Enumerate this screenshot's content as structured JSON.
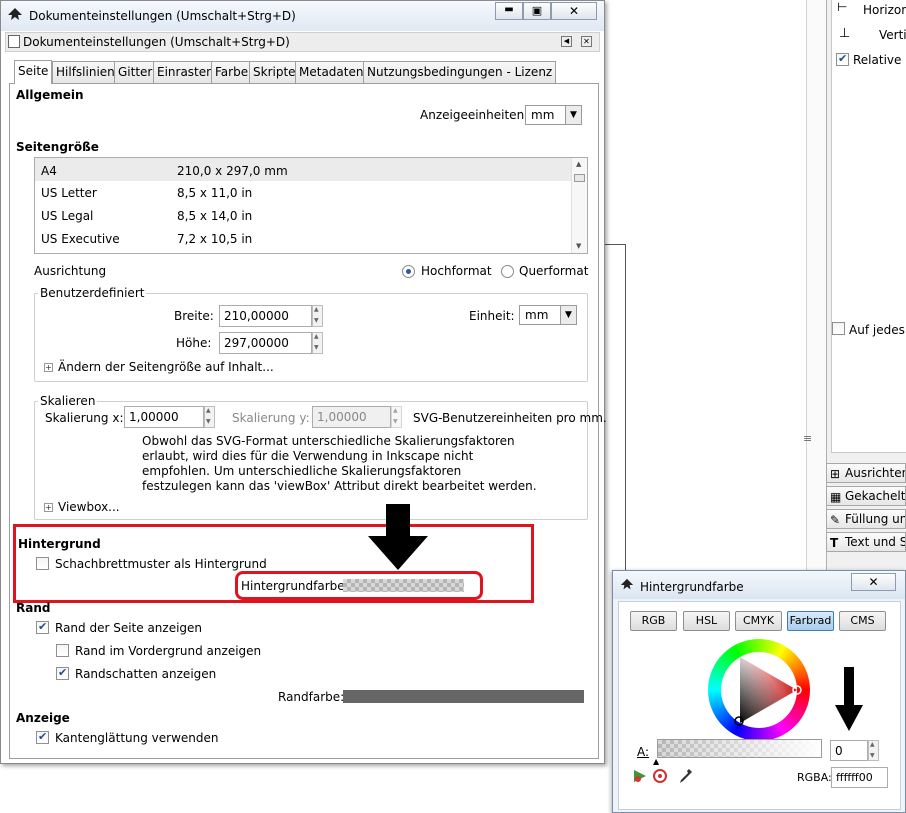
{
  "window": {
    "title": "Dokumenteinstellungen (Umschalt+Strg+D)",
    "panel_title": "Dokumenteinstellungen (Umschalt+Strg+D)"
  },
  "tabs": [
    "Seite",
    "Hilfslinien",
    "Gitter",
    "Einrasten",
    "Farbe",
    "Skripte",
    "Metadaten",
    "Nutzungsbedingungen - Lizenz"
  ],
  "general": {
    "heading": "Allgemein",
    "display_units_label": "Anzeigeeinheiten:",
    "display_units_value": "mm"
  },
  "page_size": {
    "heading": "Seitengröße",
    "rows": [
      {
        "name": "A4",
        "size": "210,0 x 297,0 mm"
      },
      {
        "name": "US Letter",
        "size": "8,5 x 11,0 in"
      },
      {
        "name": "US Legal",
        "size": "8,5 x 14,0 in"
      },
      {
        "name": "US Executive",
        "size": "7,2 x 10,5 in"
      }
    ],
    "orientation_label": "Ausrichtung",
    "portrait": "Hochformat",
    "landscape": "Querformat"
  },
  "custom": {
    "title": "Benutzerdefiniert",
    "width_label": "Breite:",
    "width_value": "210,00000",
    "height_label": "Höhe:",
    "height_value": "297,00000",
    "unit_label": "Einheit:",
    "unit_value": "mm",
    "resize_expander": "Ändern der Seitengröße auf Inhalt..."
  },
  "scale": {
    "title": "Skalieren",
    "x_label": "Skalierung x:",
    "x_value": "1,00000",
    "y_label": "Skalierung y:",
    "y_value": "1,00000",
    "units_text": "SVG-Benutzereinheiten pro mm.",
    "note_lines": [
      "Obwohl das SVG-Format unterschiedliche Skalierungsfaktoren",
      "erlaubt, wird dies für die Verwendung in Inkscape nicht",
      "empfohlen. Um unterschiedliche Skalierungsfaktoren",
      "festzulegen kann das 'viewBox' Attribut direkt bearbeitet werden."
    ],
    "viewbox_expander": "Viewbox..."
  },
  "background": {
    "heading": "Hintergrund",
    "checkerboard_label": "Schachbrettmuster als Hintergrund",
    "checkerboard_checked": false,
    "color_label": "Hintergrundfarbe:"
  },
  "border": {
    "heading": "Rand",
    "show_border": "Rand der Seite anzeigen",
    "show_border_checked": true,
    "border_on_top": "Rand im Vordergrund anzeigen",
    "border_on_top_checked": false,
    "shadow": "Randschatten anzeigen",
    "shadow_checked": true,
    "color_label": "Randfarbe:",
    "color": "#666666"
  },
  "display": {
    "heading": "Anzeige",
    "antialias": "Kantenglättung verwenden",
    "antialias_checked": true
  },
  "right_panel": {
    "horizontal": "Horizon",
    "vertical": "Verti",
    "relative": "Relative B",
    "apply_each": "Auf jedes O",
    "dock_buttons": [
      "Ausrichten",
      "Gekachelte",
      "Füllung und",
      "Text und Sc"
    ]
  },
  "color_dialog": {
    "title": "Hintergrundfarbe",
    "modes": [
      "RGB",
      "HSL",
      "CMYK",
      "Farbrad",
      "CMS"
    ],
    "active_mode": "Farbrad",
    "alpha_label": "A:",
    "alpha_value": "0",
    "rgba_label": "RGBA:",
    "rgba_value": "ffffff00"
  },
  "colors": {
    "highlight_red": "#e0141e",
    "accent_blue": "#3c7fb1",
    "hue_triangle": "#c81414"
  }
}
